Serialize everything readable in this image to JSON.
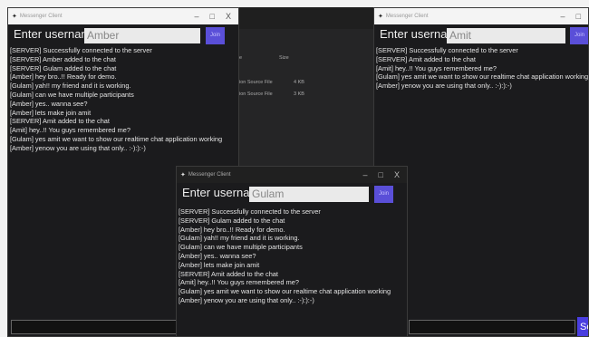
{
  "windows": {
    "amber": {
      "title": "Messenger Client",
      "username_label": "Enter username:",
      "username_value": "Amber",
      "join_label": "Join",
      "messages": [
        "[SERVER] Successfully connected to the server",
        "[SERVER] Amber added to the chat",
        "[SERVER] Gulam added to the chat",
        "[Amber] hey bro..!! Ready for demo.",
        "[Gulam] yah!! my friend  and it is working.",
        "[Gulam] can we have multiple participants",
        "[Amber] yes.. wanna see?",
        "[Amber] lets make join amit",
        "[SERVER] Amit added to the chat",
        "[Amit] hey..!! You guys remembered me?",
        "[Gulam] yes amit we want to show our realtime chat application working",
        "[Amber] yenow you are using that only.. :-):):-)"
      ],
      "controls": [
        "–",
        "□",
        "X"
      ]
    },
    "amit": {
      "title": "Messenger Client",
      "username_label": "Enter username:",
      "username_value": "Amit",
      "join_label": "Join",
      "messages": [
        "[SERVER] Successfully connected to the server",
        "[SERVER] Amit added to the chat",
        "[Amit] hey..!! You guys remembered me?",
        "[Gulam] yes amit we want to show our realtime chat application working",
        "[Amber] yenow you are using that only.. :-):):-)"
      ],
      "controls": [
        "–",
        "□"
      ],
      "send_label": "Se"
    },
    "gulam": {
      "title": "Messenger Client",
      "username_label": "Enter username:",
      "username_value": "Gulam",
      "join_label": "Join",
      "messages": [
        "[SERVER] Successfully connected to the server",
        "[SERVER] Gulam added to the chat",
        "[Amber] hey bro..!! Ready for demo.",
        "[Gulam] yah!! my friend  and it is working.",
        "[Gulam] can we have multiple participants",
        "[Amber] yes.. wanna see?",
        "[Amber] lets make join amit",
        "[SERVER] Amit added to the chat",
        "[Amit] hey..!! You guys remembered me?",
        "[Gulam] yes amit we want to show our realtime chat application working",
        "[Amber] yenow you are using that only.. :-):):-)"
      ],
      "controls": [
        "–",
        "□",
        "X"
      ]
    }
  },
  "explorer": {
    "header_type": "e",
    "header_size": "Size",
    "rows": [
      {
        "type": "ion Source File",
        "size": "4 KB"
      },
      {
        "type": "ion Source File",
        "size": "3 KB"
      }
    ]
  },
  "colors": {
    "chat_bg": "#1b1b1d",
    "join_button": "#5a4fd8",
    "send_button": "#4a3ee0"
  }
}
